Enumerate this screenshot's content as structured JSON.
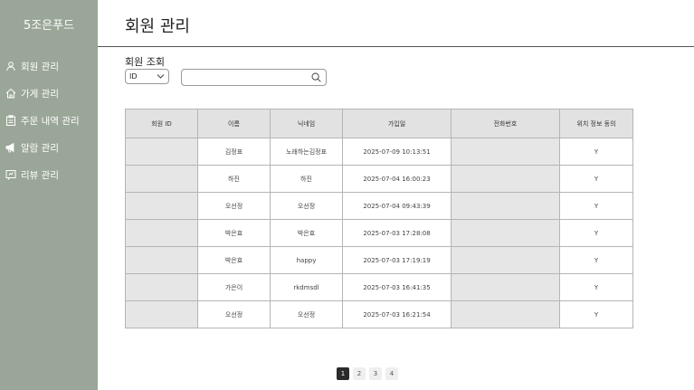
{
  "sidebar": {
    "brand": "5조은푸드",
    "items": [
      {
        "label": "회원 관리",
        "icon": "user-icon"
      },
      {
        "label": "가게 관리",
        "icon": "home-icon"
      },
      {
        "label": "주문 내역 관리",
        "icon": "clipboard-icon"
      },
      {
        "label": "알람 관리",
        "icon": "megaphone-icon"
      },
      {
        "label": "리뷰 관리",
        "icon": "review-icon"
      }
    ]
  },
  "header": {
    "title": "회원 관리"
  },
  "search": {
    "section_label": "회원 조회",
    "filter_value": "ID",
    "query": "",
    "placeholder": ""
  },
  "table": {
    "columns": [
      "회원 ID",
      "이름",
      "닉네임",
      "가입일",
      "전화번호",
      "위치 정보 동의"
    ],
    "rows": [
      {
        "member_id": "",
        "name": "김정표",
        "nickname": "노래하는김정표",
        "joined": "2025-07-09 10:13:51",
        "phone": "",
        "location_consent": "Y"
      },
      {
        "member_id": "",
        "name": "하진",
        "nickname": "하진",
        "joined": "2025-07-04 16:00:23",
        "phone": "",
        "location_consent": "Y"
      },
      {
        "member_id": "",
        "name": "오선정",
        "nickname": "오선정",
        "joined": "2025-07-04 09:43:39",
        "phone": "",
        "location_consent": "Y"
      },
      {
        "member_id": "",
        "name": "박은효",
        "nickname": "박은효",
        "joined": "2025-07-03 17:28:08",
        "phone": "",
        "location_consent": "Y"
      },
      {
        "member_id": "",
        "name": "박은효",
        "nickname": "happy",
        "joined": "2025-07-03 17:19:19",
        "phone": "",
        "location_consent": "Y"
      },
      {
        "member_id": "",
        "name": "가은이",
        "nickname": "rkdmsdl",
        "joined": "2025-07-03 16:41:35",
        "phone": "",
        "location_consent": "Y"
      },
      {
        "member_id": "",
        "name": "오선정",
        "nickname": "오선정",
        "joined": "2025-07-03 16:21:54",
        "phone": "",
        "location_consent": "Y"
      }
    ]
  },
  "pagination": {
    "pages": [
      "1",
      "2",
      "3",
      "4"
    ],
    "current": "1"
  },
  "colors": {
    "sidebar": "#9aa697",
    "header_cell": "#e2e2e2",
    "masked_cell": "#e6e6e6",
    "active_page": "#2b2b2b"
  }
}
